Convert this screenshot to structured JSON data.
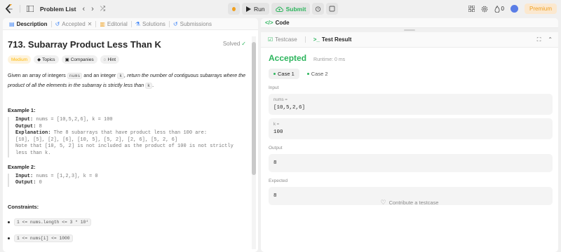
{
  "topbar": {
    "problem_list": "Problem List",
    "run": "Run",
    "submit": "Submit",
    "streak": "0",
    "premium": "Premium"
  },
  "left_tabs": [
    {
      "label": "Description",
      "icon": "document-icon"
    },
    {
      "label": "Accepted",
      "icon": "history-icon"
    },
    {
      "label": "Editorial",
      "icon": "book-icon"
    },
    {
      "label": "Solutions",
      "icon": "flask-icon"
    },
    {
      "label": "Submissions",
      "icon": "clock-icon"
    }
  ],
  "problem": {
    "title": "713. Subarray Product Less Than K",
    "solved": "Solved",
    "difficulty": "Medium",
    "chips": [
      "Topics",
      "Companies",
      "Hint"
    ],
    "desc_1": "Given an array of integers ",
    "desc_code1": "nums",
    "desc_2": " and an integer ",
    "desc_code2": "k",
    "desc_3": ", return the number of contiguous subarrays where the product of all the elements in the subarray is strictly less than ",
    "desc_code3": "k",
    "desc_4": ".",
    "examples": [
      {
        "title": "Example 1:",
        "input_label": "Input:",
        "input": " nums = [10,5,2,6], k = 100",
        "output_label": "Output:",
        "output": " 8",
        "expl_label": "Explanation:",
        "expl": " The 8 subarrays that have product less than 100 are:",
        "expl_lines": [
          "[10], [5], [2], [6], [10, 5], [5, 2], [2, 6], [5, 2, 6]",
          "Note that [10, 5, 2] is not included as the product of 100 is not strictly",
          "less than k."
        ]
      },
      {
        "title": "Example 2:",
        "input_label": "Input:",
        "input": " nums = [1,2,3], k = 0",
        "output_label": "Output:",
        "output": " 0"
      }
    ],
    "constraints_title": "Constraints:",
    "constraints": [
      "1 <= nums.length <= 3 * 10⁴",
      "1 <= nums[i] <= 1000"
    ]
  },
  "right": {
    "code_label": "Code",
    "testcase_tab": "Testcase",
    "result_tab": "Test Result",
    "status": "Accepted",
    "runtime": "Runtime: 0 ms",
    "cases": [
      "Case 1",
      "Case 2"
    ],
    "input_label": "Input",
    "param1_name": "nums =",
    "param1_value": "[10,5,2,6]",
    "param2_name": "k =",
    "param2_value": "100",
    "output_label": "Output",
    "output_value": "8",
    "expected_label": "Expected",
    "expected_value": "8",
    "contribute": "Contribute a testcase"
  },
  "colors": {
    "accent_green": "#2db55d",
    "medium": "#ffb800",
    "premium": "#f0a020"
  }
}
